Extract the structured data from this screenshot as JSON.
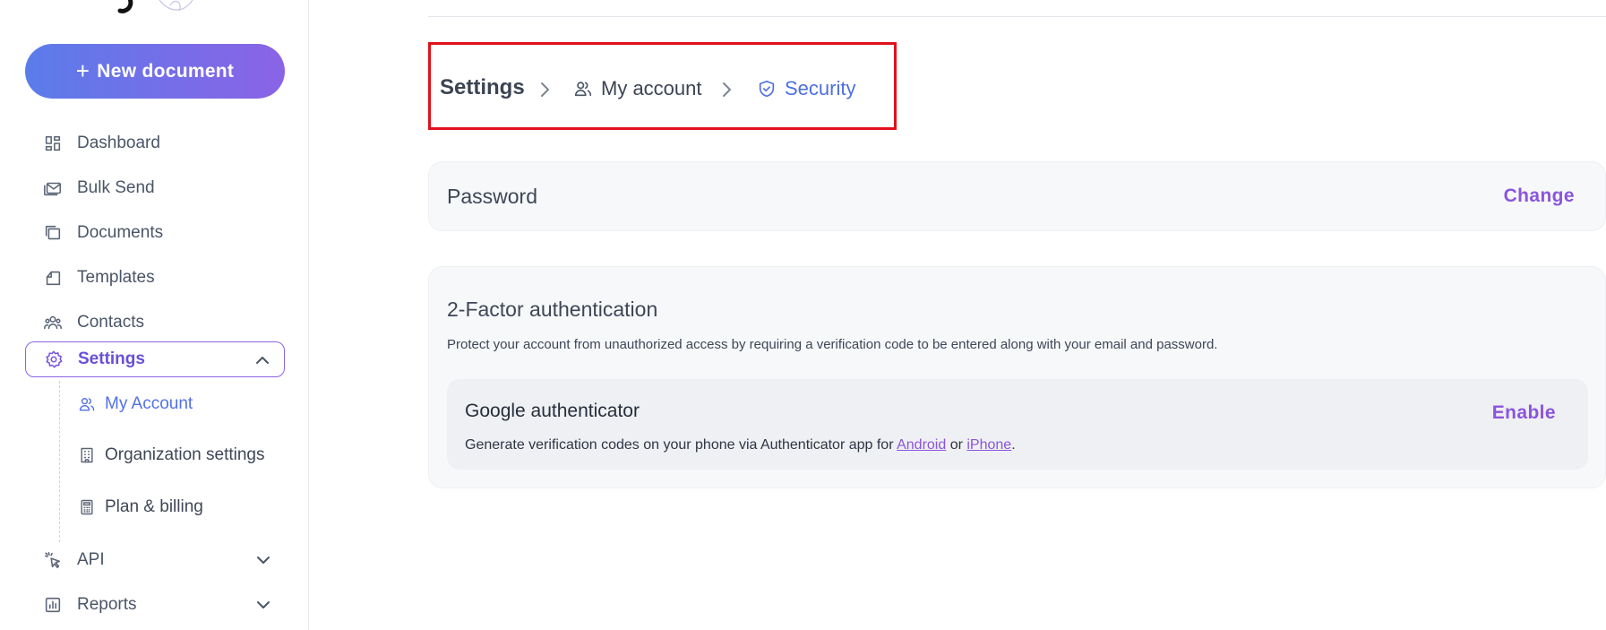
{
  "sidebar": {
    "new_document_label": "New document",
    "items": [
      {
        "label": "Dashboard",
        "icon": "dashboard-icon"
      },
      {
        "label": "Bulk Send",
        "icon": "bulk-send-icon"
      },
      {
        "label": "Documents",
        "icon": "documents-icon"
      },
      {
        "label": "Templates",
        "icon": "templates-icon"
      },
      {
        "label": "Contacts",
        "icon": "contacts-icon"
      },
      {
        "label": "Settings",
        "icon": "gear-icon",
        "expanded": true
      },
      {
        "label": "API",
        "icon": "api-icon",
        "expanded": false
      },
      {
        "label": "Reports",
        "icon": "reports-icon",
        "expanded": false
      }
    ],
    "settings_sub_items": [
      {
        "label": "My Account",
        "icon": "users-icon",
        "active": true
      },
      {
        "label": "Organization settings",
        "icon": "building-icon"
      },
      {
        "label": "Plan & billing",
        "icon": "calculator-icon"
      }
    ]
  },
  "breadcrumb": {
    "root": "Settings",
    "account": "My account",
    "current": "Security"
  },
  "password_card": {
    "title": "Password",
    "action": "Change"
  },
  "two_factor": {
    "title": "2-Factor authentication",
    "description": "Protect your account from unauthorized access by requiring a verification code to be entered along with your email and password.",
    "provider": {
      "name": "Google authenticator",
      "text_before": "Generate verification codes on your phone via Authenticator app for ",
      "android_link": "Android",
      "text_middle": " or ",
      "iphone_link": "iPhone",
      "text_after": ".",
      "action": "Enable"
    }
  },
  "colors": {
    "accent_purple": "#8a55de",
    "accent_blue": "#4f6fe0",
    "gradient_start": "#5b7cea",
    "gradient_end": "#8a63e6",
    "highlight_box": "#e0101c"
  }
}
